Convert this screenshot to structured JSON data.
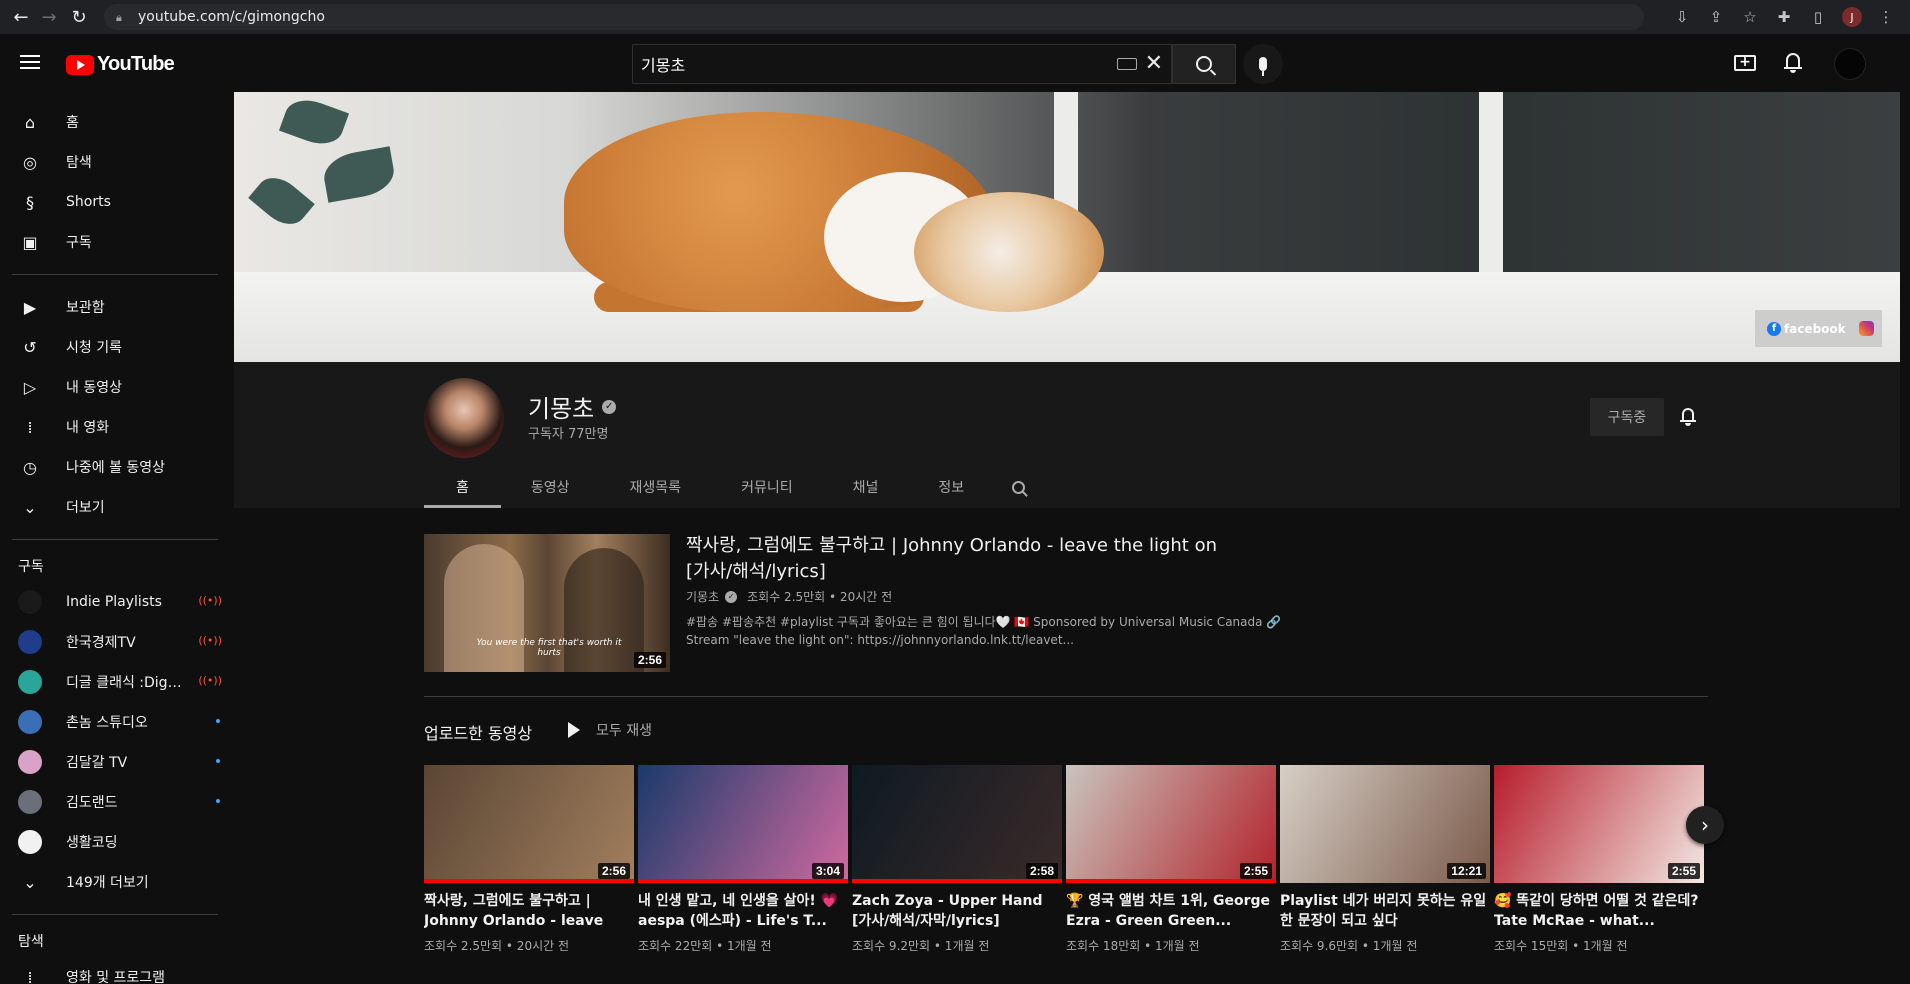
{
  "browser": {
    "url": "youtube.com/c/gimongcho",
    "profile_initial": "J"
  },
  "header": {
    "logo_text": "YouTube",
    "search_value": "기몽초"
  },
  "sidebar": {
    "main": [
      {
        "label": "홈",
        "icon": "home-icon"
      },
      {
        "label": "탐색",
        "icon": "compass-icon"
      },
      {
        "label": "Shorts",
        "icon": "shorts-icon"
      },
      {
        "label": "구독",
        "icon": "subscriptions-icon"
      }
    ],
    "library": [
      {
        "label": "보관함",
        "icon": "library-icon"
      },
      {
        "label": "시청 기록",
        "icon": "history-icon"
      },
      {
        "label": "내 동영상",
        "icon": "my-videos-icon"
      },
      {
        "label": "내 영화",
        "icon": "movies-icon"
      },
      {
        "label": "나중에 볼 동영상",
        "icon": "watch-later-icon"
      },
      {
        "label": "더보기",
        "icon": "chevron-down-icon"
      }
    ],
    "subscriptions_title": "구독",
    "subscriptions": [
      {
        "name": "Indie Playlists",
        "status": "live",
        "color": "#1a1a1a"
      },
      {
        "name": "한국경제TV",
        "status": "live",
        "color": "#1f3d8a"
      },
      {
        "name": "디글 클래식 :Diggl...",
        "status": "live",
        "color": "#2aa59a"
      },
      {
        "name": "촌놈 스튜디오",
        "status": "new",
        "color": "#3b6fb5"
      },
      {
        "name": "김달갈 TV",
        "status": "new",
        "color": "#d9a3c8"
      },
      {
        "name": "김도랜드",
        "status": "new",
        "color": "#6a6f7a"
      },
      {
        "name": "생활코딩",
        "status": "none",
        "color": "#f1f1f1"
      }
    ],
    "more_subs": "149개 더보기",
    "explore_title": "탐색",
    "explore_first": "영화 및 프로그램"
  },
  "banner": {
    "facebook_label": "facebook"
  },
  "channel": {
    "name": "기몽초",
    "subscribers": "구독자 77만명",
    "subscribed_label": "구독중",
    "tabs": [
      "홈",
      "동영상",
      "재생목록",
      "커뮤니티",
      "채널",
      "정보"
    ]
  },
  "featured": {
    "title": "짝사랑, 그럼에도 불구하고 | Johnny Orlando - leave the light on [가사/해석/lyrics]",
    "channel": "기몽초",
    "meta": "조회수 2.5만회 • 20시간 전",
    "desc1": "#팝송 #팝송추천 #playlist 구독과 좋아요는 큰 힘이 됩니다🤍 🇨🇦 Sponsored by Universal Music Canada 🔗",
    "desc2": "Stream \"leave the light on\": https://johnnyorlando.lnk.tt/leavet...",
    "duration": "2:56",
    "subtitle": "You were the first that's worth it hurts"
  },
  "uploads": {
    "title": "업로드한 동영상",
    "play_all": "모두 재생",
    "videos": [
      {
        "title": "짝사랑, 그럼에도 불구하고 | Johnny Orlando - leave the...",
        "meta": "조회수 2.5만회 • 20시간 전",
        "duration": "2:56",
        "color1": "#5a4634",
        "color2": "#a27f5e",
        "progress": 1.0
      },
      {
        "title": "내 인생 맡고, 네 인생을 살아! 💗 aespa (에스파) - Life's T...",
        "meta": "조회수 22만회 • 1개월 전",
        "duration": "3:04",
        "color1": "#1a3a6a",
        "color2": "#d06aa0",
        "progress": 1.0
      },
      {
        "title": "Zach Zoya - Upper Hand [가사/해석/자막/lyrics]",
        "meta": "조회수 9.2만회 • 1개월 전",
        "duration": "2:58",
        "color1": "#0e1a22",
        "color2": "#3a2a2a",
        "progress": 1.0
      },
      {
        "title": "🏆 영국 앨범 차트 1위, George Ezra - Green Green...",
        "meta": "조회수 18만회 • 1개월 전",
        "duration": "2:55",
        "color1": "#c9c4bd",
        "color2": "#b2232b",
        "progress": 1.0
      },
      {
        "title": "Playlist 네가 버리지 못하는 유일한 문장이 되고 싶다",
        "meta": "조회수 9.6만회 • 1개월 전",
        "duration": "12:21",
        "color1": "#d7cfc6",
        "color2": "#7a5a4a",
        "progress": 0
      },
      {
        "title": "🥰 똑같이 당하면 어떨 것 같은데? Tate McRae - what...",
        "meta": "조회수 15만회 • 1개월 전",
        "duration": "2:55",
        "color1": "#b71c2b",
        "color2": "#f2e9e3",
        "progress": 0
      }
    ]
  }
}
